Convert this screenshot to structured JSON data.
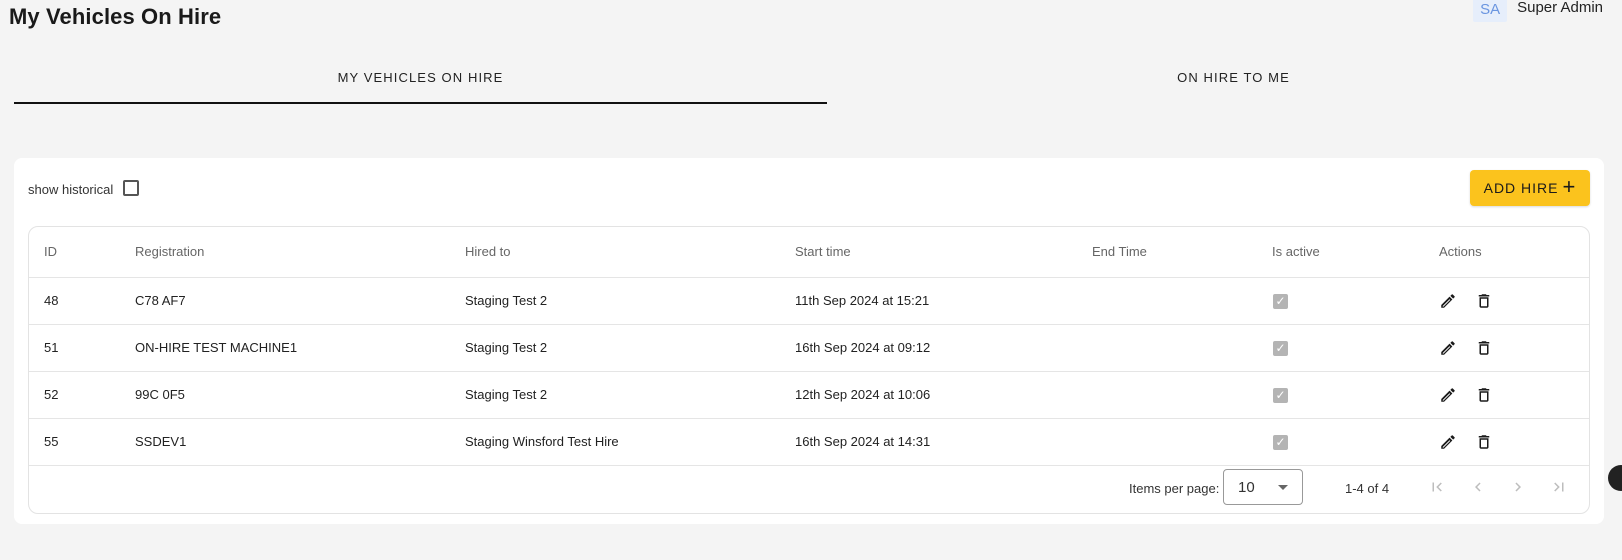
{
  "page": {
    "title": "My Vehicles On Hire"
  },
  "user": {
    "initials": "SA",
    "name": "Super Admin"
  },
  "tabs": [
    {
      "label": "MY VEHICLES ON HIRE",
      "active": true
    },
    {
      "label": "ON HIRE TO ME",
      "active": false
    }
  ],
  "toolbar": {
    "show_historical_label": "show historical",
    "show_historical_checked": false,
    "add_hire_label": "ADD HIRE",
    "add_hire_color": "#fbc31d"
  },
  "table": {
    "columns": [
      "ID",
      "Registration",
      "Hired to",
      "Start time",
      "End Time",
      "Is active",
      "Actions"
    ],
    "rows": [
      {
        "id": "48",
        "registration": "C78 AF7",
        "hired_to": "Staging Test 2",
        "start_time": "11th Sep 2024 at 15:21",
        "end_time": "",
        "is_active": true
      },
      {
        "id": "51",
        "registration": "ON-HIRE TEST MACHINE1",
        "hired_to": "Staging Test 2",
        "start_time": "16th Sep 2024 at 09:12",
        "end_time": "",
        "is_active": true
      },
      {
        "id": "52",
        "registration": "99C 0F5",
        "hired_to": "Staging Test 2",
        "start_time": "12th Sep 2024 at 10:06",
        "end_time": "",
        "is_active": true
      },
      {
        "id": "55",
        "registration": "SSDEV1",
        "hired_to": "Staging Winsford Test Hire",
        "start_time": "16th Sep 2024 at 14:31",
        "end_time": "",
        "is_active": true
      }
    ]
  },
  "paginator": {
    "items_per_page_label": "Items per page:",
    "items_per_page_value": "10",
    "range_label": "1-4 of 4"
  },
  "icons": {
    "edit": "pencil-icon",
    "delete": "trash-icon",
    "add": "plus-icon",
    "first": "first-page-icon",
    "prev": "chevron-left-icon",
    "next": "chevron-right-icon",
    "last": "last-page-icon"
  }
}
